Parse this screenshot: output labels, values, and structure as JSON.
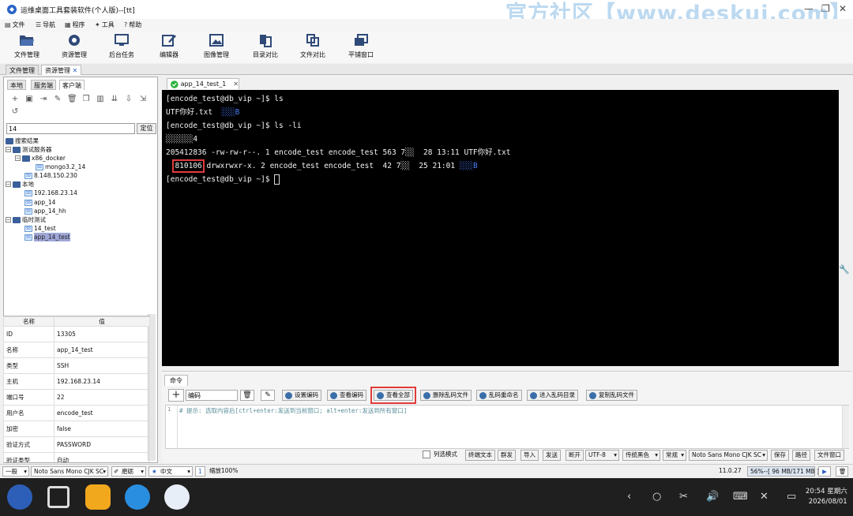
{
  "window": {
    "title": "运维桌面工具套装软件(个人版)--[tt]",
    "watermark": "官方社区【www.deskui.com】"
  },
  "menubar": {
    "items": [
      "文件",
      "导航",
      "程序",
      "工具",
      "帮助"
    ]
  },
  "toolbar": {
    "buttons": [
      {
        "label": "文件管理",
        "icon": "folder-open-icon"
      },
      {
        "label": "资源管理",
        "icon": "resource-icon"
      },
      {
        "label": "后台任务",
        "icon": "monitor-icon"
      },
      {
        "label": "编辑器",
        "icon": "edit-icon"
      },
      {
        "label": "图像管理",
        "icon": "image-icon"
      },
      {
        "label": "目录对比",
        "icon": "dir-compare-icon"
      },
      {
        "label": "文件对比",
        "icon": "file-compare-icon"
      },
      {
        "label": "平铺窗口",
        "icon": "tile-windows-icon"
      }
    ]
  },
  "manager_tabs": [
    "文件管理",
    "资源管理"
  ],
  "side_tabs": [
    "本地",
    "服务端",
    "客户端"
  ],
  "search": {
    "value": "14",
    "locate_label": "定位"
  },
  "tree": {
    "root": "搜索结果",
    "g1": "测试服务器",
    "g1_sub": "x86_docker",
    "g1_sub_host": "mongo3.2_14",
    "g1_host": "8.148.150.230",
    "g2": "本地",
    "g2_h1": "192.168.23.14",
    "g2_h2": "app_14",
    "g2_h3": "app_14_hh",
    "g3": "临时测试",
    "g3_h1": "14_test",
    "g3_h2": "app_14_test"
  },
  "props": {
    "header": {
      "name": "名称",
      "value": "值"
    },
    "rows": [
      {
        "k": "ID",
        "v": "13305"
      },
      {
        "k": "名称",
        "v": "app_14_test"
      },
      {
        "k": "类型",
        "v": "SSH"
      },
      {
        "k": "主机",
        "v": "192.168.23.14"
      },
      {
        "k": "端口号",
        "v": "22"
      },
      {
        "k": "用户名",
        "v": "encode_test"
      },
      {
        "k": "加密",
        "v": "false"
      },
      {
        "k": "验证方式",
        "v": "PASSWORD"
      },
      {
        "k": "验证类型",
        "v": "自动"
      }
    ]
  },
  "terminal_tab": {
    "label": "app_14_test_1"
  },
  "terminal": {
    "l1": "[encode_test@db_vip ~]$ ls",
    "l2a": "UTF你好.txt  ",
    "l2b": "░░░B",
    "l3": "[encode_test@db_vip ~]$ ls -li",
    "l4": "░░░░░░4",
    "l5": "205412836 -rw-rw-r--. 1 encode_test encode_test 563 7░░  28 13:11 UTF你好.txt",
    "l6a": "  ",
    "l6b": "810106",
    "l6c": " drwxrwxr-x. 2 encode_test encode_test  42 7░░  25 21:01 ",
    "l6d": "░░░B",
    "l7": "[encode_test@db_vip ~]$ "
  },
  "cmd": {
    "tab": "命令",
    "encoding_input": "编码",
    "buttons": [
      "设置编码",
      "查看编码",
      "查看全部",
      "删除乱码文件",
      "乱码重命名",
      "进入乱码目录",
      "复制乱码文件"
    ],
    "hint": "# 提示: 选取内容后[ctrl+enter:发送到当前窗口; alt+enter:发送到所有窗口]",
    "line_no": "1"
  },
  "cmd_status": {
    "column_mode": "列选模式",
    "terminal_text": "终端文本",
    "group_send": "群发",
    "import": "导入",
    "send": "发送",
    "disconnect": "断开",
    "encoding": "UTF-8",
    "theme": "传统黑色",
    "style": "常规",
    "font": "Noto Sans Mono CJK SC",
    "save": "保存",
    "path": "路径",
    "file_window": "文件窗口"
  },
  "statusbar": {
    "level": "一般",
    "font": "Noto Sans Mono CJK SC",
    "weight": "磨砺",
    "lang": "中文",
    "size": "1",
    "zoom": "缩放100%",
    "version": "11.0.27",
    "memory": "56%--[ 96 MB/171 MB ]"
  },
  "clock": {
    "time": "20:54 星期六",
    "date": "2026/08/01"
  }
}
